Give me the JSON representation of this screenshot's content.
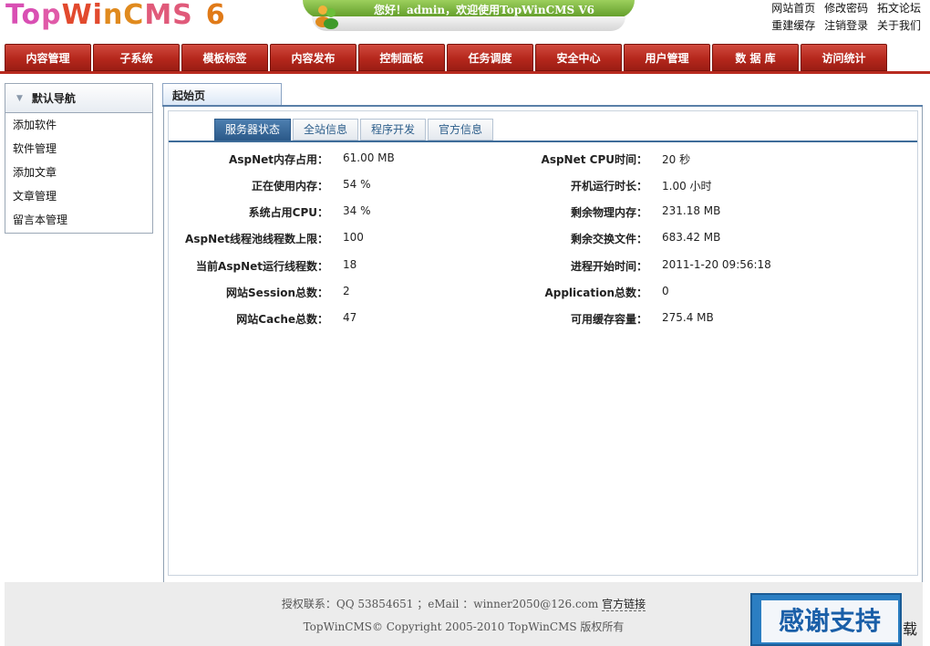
{
  "header": {
    "logo": "TopWinCMS",
    "logo_version": "6",
    "welcome": "您好！admin，欢迎使用TopWinCMS V6",
    "links_row1": [
      "网站首页",
      "修改密码",
      "拓文论坛"
    ],
    "links_row2": [
      "重建缓存",
      "注销登录",
      "关于我们"
    ]
  },
  "nav": [
    "内容管理",
    "子系统",
    "模板标签",
    "内容发布",
    "控制面板",
    "任务调度",
    "安全中心",
    "用户管理",
    "数 据 库",
    "访问统计"
  ],
  "sidebar": {
    "title": "默认导航",
    "items": [
      "添加软件",
      "软件管理",
      "添加文章",
      "文章管理",
      "留言本管理"
    ]
  },
  "main": {
    "tab": "起始页",
    "subtabs": [
      "服务器状态",
      "全站信息",
      "程序开发",
      "官方信息"
    ],
    "active_subtab": "服务器状态",
    "stats_left": [
      {
        "label": "AspNet内存占用：",
        "value": "61.00 MB"
      },
      {
        "label": "正在使用内存：",
        "value": "54 %"
      },
      {
        "label": "系统占用CPU：",
        "value": "34 %"
      },
      {
        "label": "AspNet线程池线程数上限：",
        "value": "100"
      },
      {
        "label": "当前AspNet运行线程数：",
        "value": "18"
      },
      {
        "label": "网站Session总数：",
        "value": "2"
      },
      {
        "label": "网站Cache总数：",
        "value": "47"
      }
    ],
    "stats_right": [
      {
        "label": "AspNet CPU时间：",
        "value": "20 秒"
      },
      {
        "label": "开机运行时长：",
        "value": "1.00 小时"
      },
      {
        "label": "剩余物理内存：",
        "value": "231.18 MB"
      },
      {
        "label": "剩余交换文件：",
        "value": "683.42 MB"
      },
      {
        "label": "进程开始时间：",
        "value": "2011-1-20 09:56:18"
      },
      {
        "label": "Application总数：",
        "value": "0"
      },
      {
        "label": "可用缓存容量：",
        "value": "275.4 MB"
      }
    ]
  },
  "footer": {
    "contact": "授权联系：QQ 53854651 ；eMail ：winner2050@126.com",
    "official_link": "官方链接",
    "copyright": "TopWinCMS© Copyright 2005-2010 TopWinCMS 版权所有"
  },
  "overlay": {
    "thanks": "感谢支持",
    "tail": "载"
  }
}
